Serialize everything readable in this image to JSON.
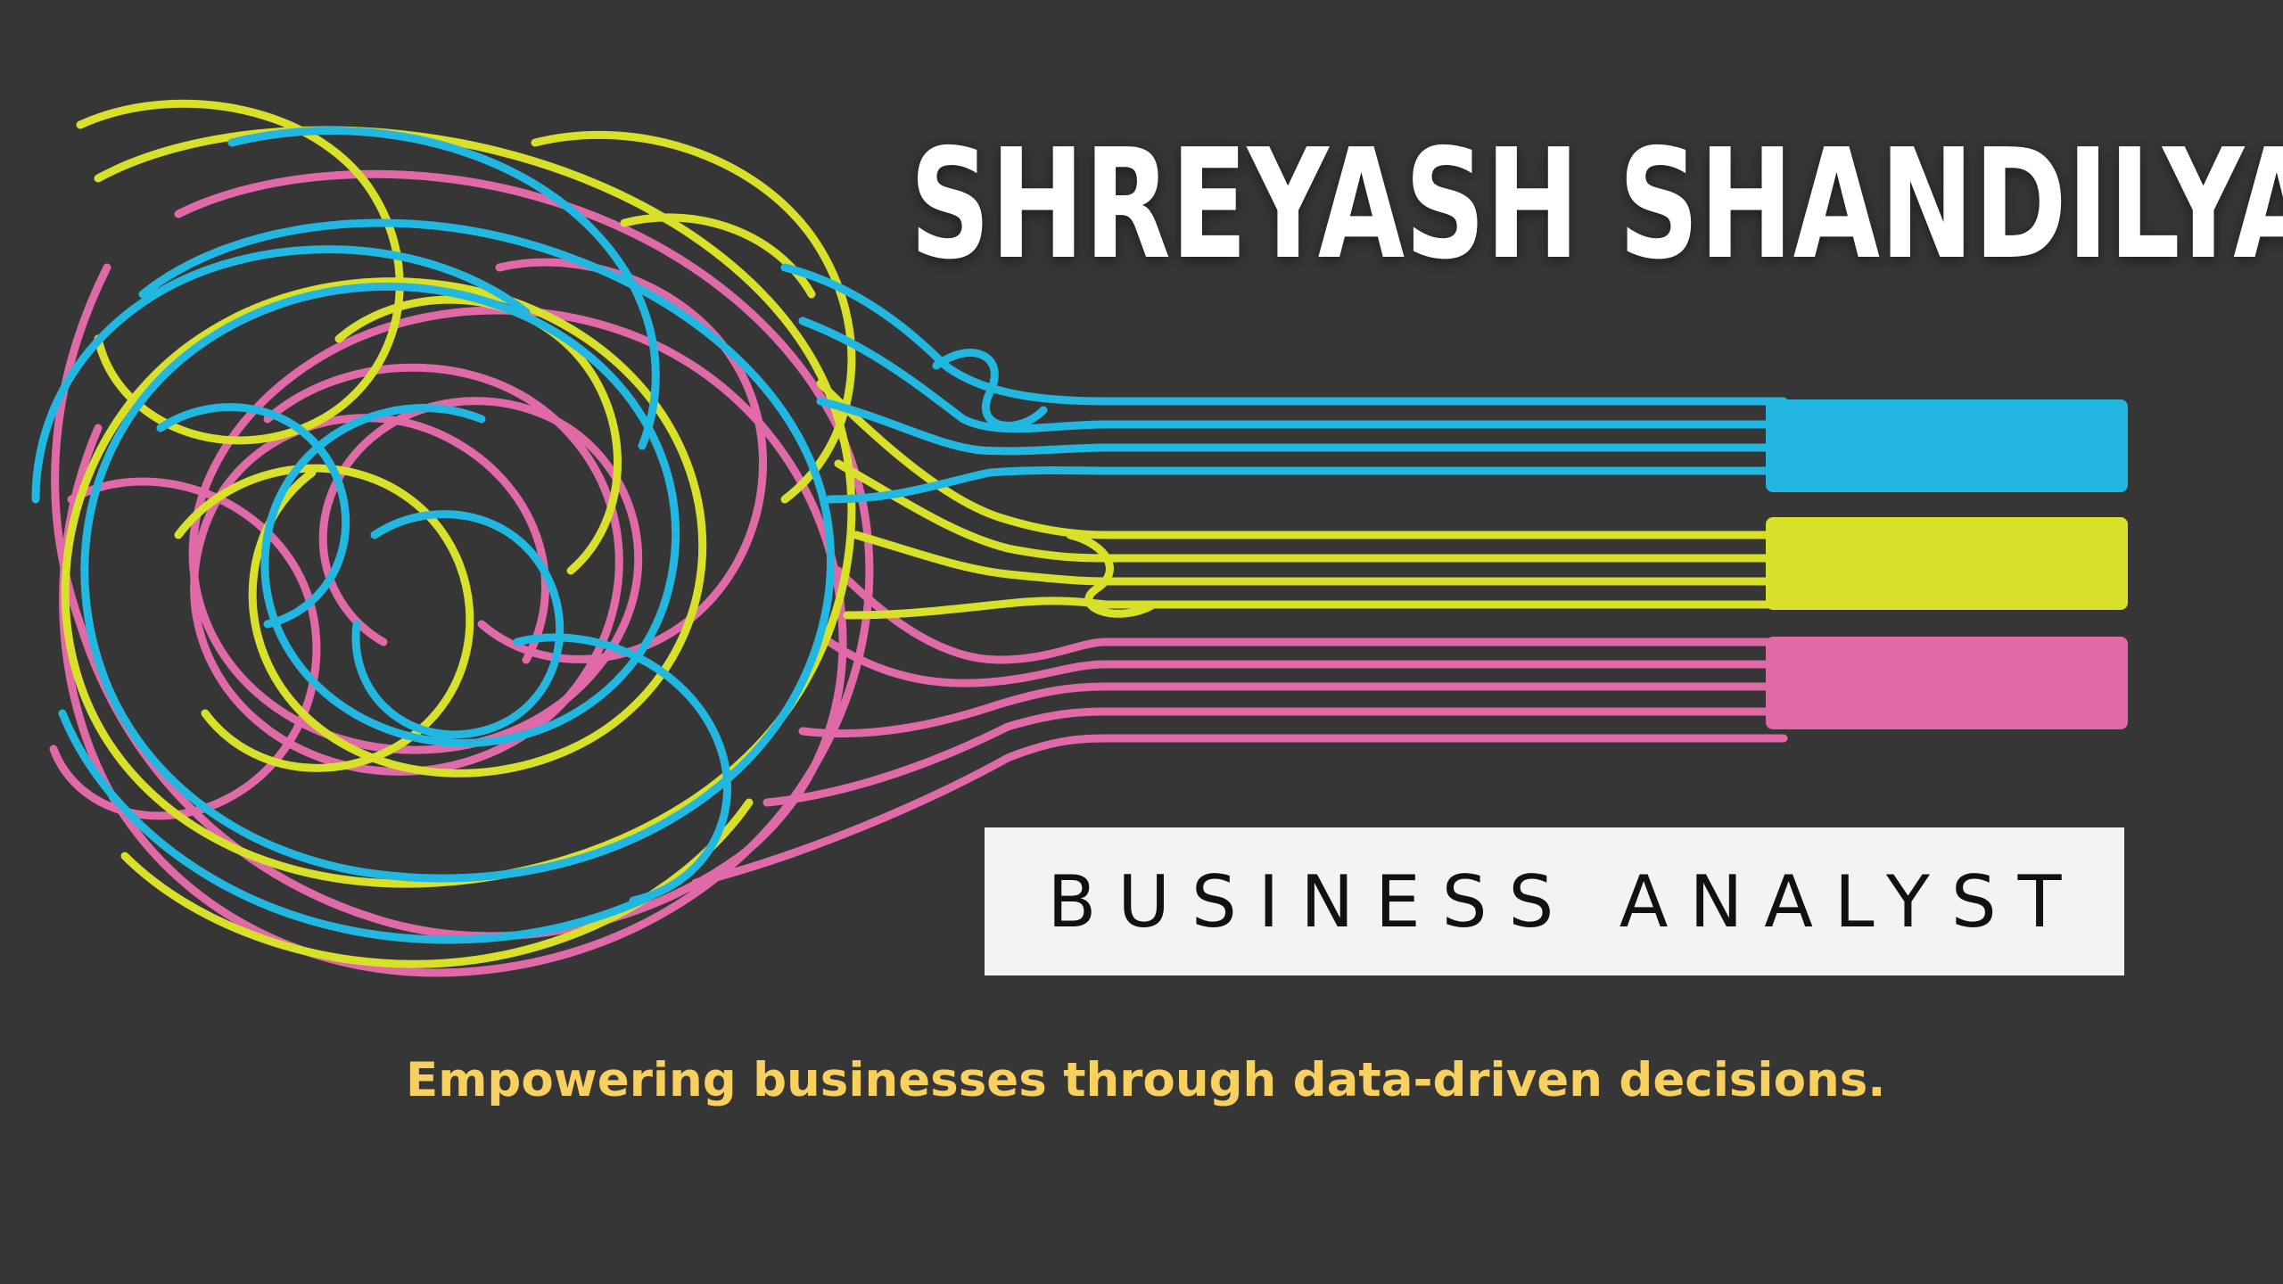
{
  "header": {
    "name": "SHREYASH SHANDILYA"
  },
  "role": {
    "label": "BUSINESS ANALYST"
  },
  "tagline": {
    "text": "Empowering businesses through data-driven decisions."
  },
  "colors": {
    "background": "#363636",
    "cyan": "#22b7e0",
    "yellow": "#d9e02a",
    "pink": "#e06aa8",
    "name_text": "#ffffff",
    "tagline_text": "#f7d060",
    "role_box": "#f3f3f3"
  },
  "graphic": {
    "description_icon": "tangled-lines-to-straight-bars"
  }
}
